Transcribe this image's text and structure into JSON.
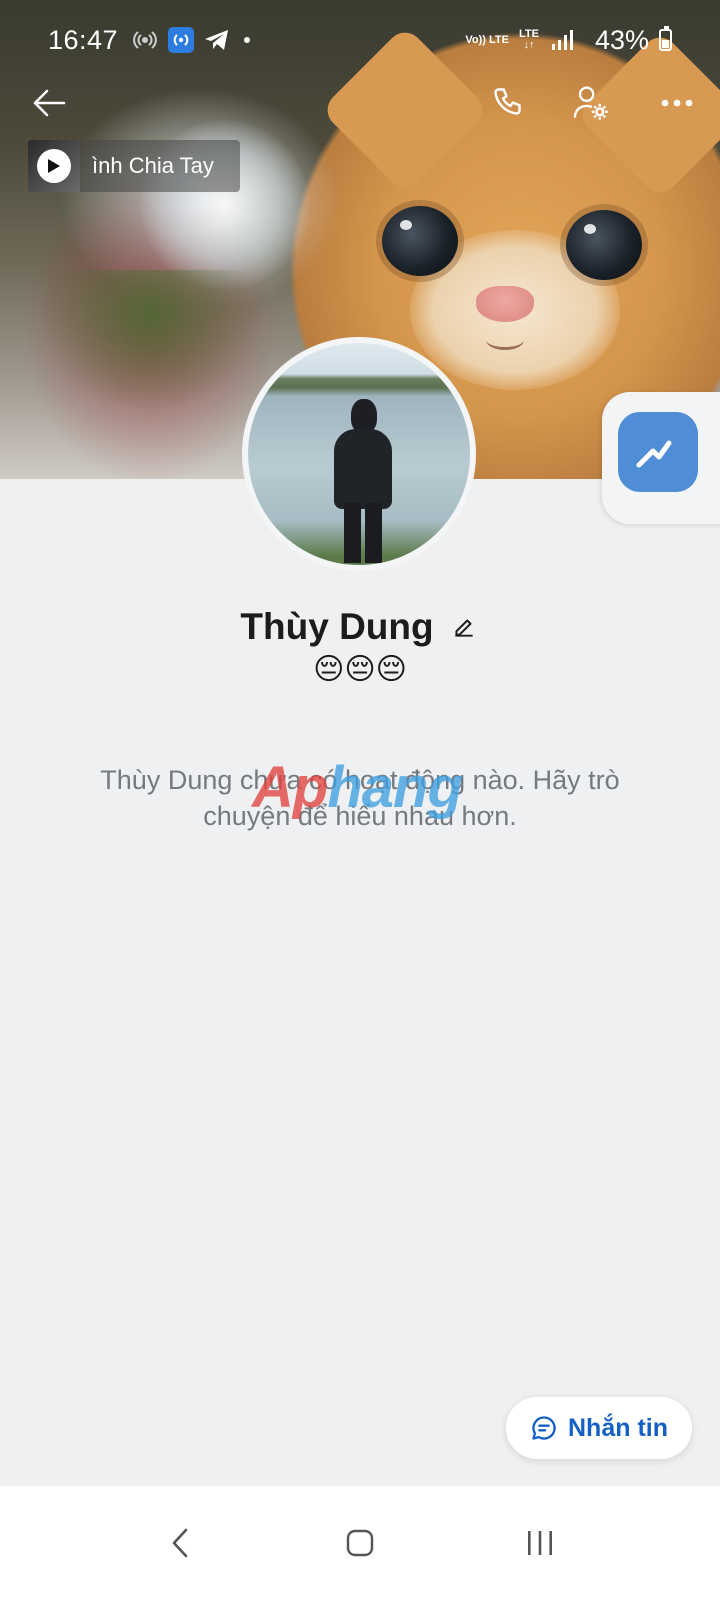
{
  "status_bar": {
    "time": "16:47",
    "network_label": "Vo)) LTE",
    "lte_label": "LTE",
    "battery_percent": "43%",
    "battery_level": 0.43,
    "icons": [
      "wifi-hotspot-icon",
      "hotspot-app-icon",
      "telegram-icon",
      "notification-dot-icon",
      "signal-icon",
      "battery-icon"
    ]
  },
  "header": {
    "back_icon": "arrow-left-icon",
    "call_icon": "phone-icon",
    "settings_icon": "user-settings-icon",
    "more_icon": "more-horizontal-icon"
  },
  "music": {
    "title": "ình Chia Tay",
    "icon": "play-icon"
  },
  "profile": {
    "name": "Thùy Dung",
    "edit_icon": "pencil-icon",
    "status": "😔😔😔",
    "empty_message": "Thùy Dung chưa có hoạt động nào. Hãy trò chuyện để hiểu nhau hơn."
  },
  "watermark": {
    "part_a": "Ap",
    "part_b": "hang"
  },
  "floating_assistant": {
    "icon": "link-assistant-icon"
  },
  "message_button": {
    "label": "Nhắn tin",
    "icon": "chat-bubble-icon"
  },
  "nav_bar": {
    "back_icon": "nav-back-icon",
    "home_icon": "nav-home-icon",
    "recents_icon": "nav-recents-icon"
  },
  "colors": {
    "accent": "#1560c4",
    "background": "#eef0f2",
    "assistant": "#4f8ed6",
    "secondary_text": "#767a80"
  }
}
